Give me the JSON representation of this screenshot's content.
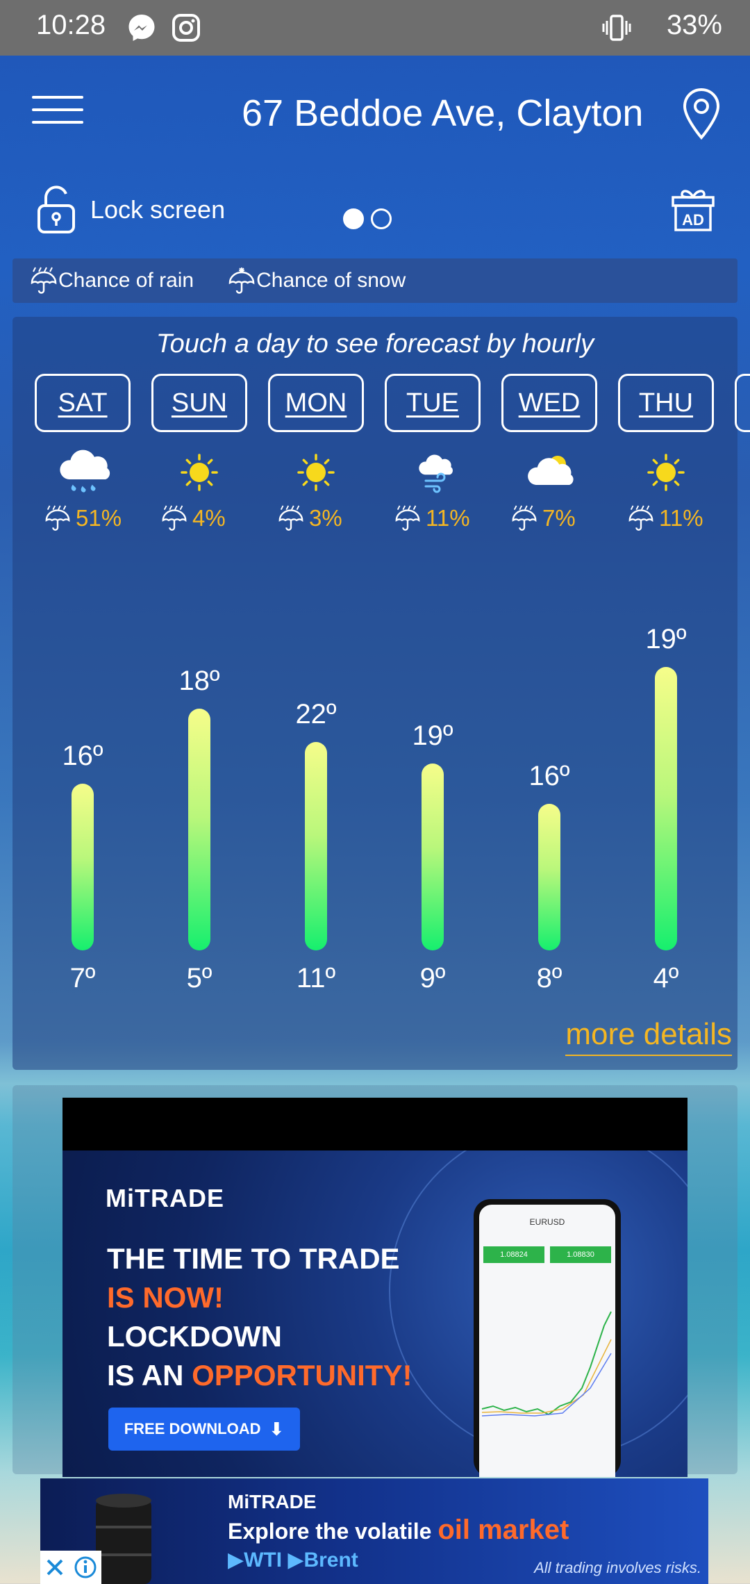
{
  "status_bar": {
    "time": "10:28",
    "battery": "33%"
  },
  "header": {
    "location": "67 Beddoe Ave, Clayton V"
  },
  "toolbar": {
    "lock_label": "Lock screen",
    "ad_badge": "AD"
  },
  "legend": {
    "rain_label": "Chance of rain",
    "snow_label": "Chance of snow"
  },
  "forecast": {
    "hint": "Touch a day to see forecast by hourly",
    "more_details": "more details"
  },
  "chart_data": {
    "type": "bar",
    "categories": [
      "SAT",
      "SUN",
      "MON",
      "TUE",
      "WED",
      "THU"
    ],
    "conditions": [
      "rain",
      "sunny",
      "sunny",
      "windy-cloud",
      "partly-cloudy",
      "sunny"
    ],
    "rain_chance": [
      "51%",
      "4%",
      "3%",
      "11%",
      "7%",
      "11%"
    ],
    "high_labels": [
      "16º",
      "18º",
      "22º",
      "19º",
      "16º",
      "19º"
    ],
    "low_labels": [
      "7º",
      "5º",
      "11º",
      "9º",
      "8º",
      "4º"
    ],
    "bar_fraction": [
      0.5,
      0.725,
      0.625,
      0.56,
      0.44,
      0.85
    ],
    "colors": {
      "bar_top": "#f6fd8a",
      "bar_bottom": "#16ef6e",
      "accent": "#f4b623"
    }
  },
  "ad": {
    "brand": "MiTRADE",
    "line1": "THE TIME TO TRADE",
    "line2": "IS NOW!",
    "line3": "LOCKDOWN",
    "line4a": "IS AN ",
    "line4b": "OPPORTUNITY!",
    "button": "FREE DOWNLOAD",
    "phone_pair": "EURUSD",
    "phone_sell": "1.08824",
    "phone_buy": "1.08830"
  },
  "banner": {
    "brand": "MiTRADE",
    "line1a": "Explore the volatile ",
    "line1b": "oil market",
    "line2": "▶WTI   ▶Brent",
    "disclaimer": "All trading involves risks."
  }
}
